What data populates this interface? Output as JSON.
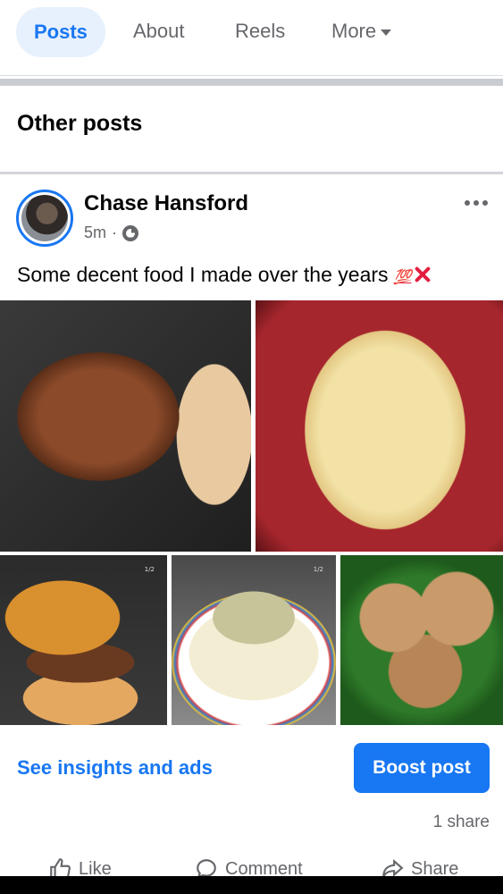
{
  "tabs": [
    {
      "label": "Posts",
      "active": true
    },
    {
      "label": "About"
    },
    {
      "label": "Reels"
    },
    {
      "label": "More"
    }
  ],
  "section": {
    "title": "Other posts"
  },
  "post": {
    "author": "Chase Hansford",
    "time": "5m",
    "separator": "·",
    "privacy_icon": "globe-icon",
    "caption": "Some decent food I made over the years",
    "caption_emoji_1": "💯",
    "caption_emoji_2": "💢",
    "photos": [
      {
        "subject": "burger patty and chicken on grill pan"
      },
      {
        "subject": "omelette in red pan"
      },
      {
        "subject": "burger in bun",
        "tag": "1/2"
      },
      {
        "subject": "penne pasta with chicken",
        "tag": "1/2"
      },
      {
        "subject": "meatballs with sauce on greens"
      }
    ]
  },
  "footer": {
    "insights_link": "See insights and ads",
    "boost_button": "Boost post",
    "share_count": "1 share"
  },
  "actions": {
    "like": "Like",
    "comment": "Comment",
    "share": "Share"
  },
  "colors": {
    "accent": "#1877f2",
    "secondary_text": "#65676b",
    "active_tab_bg": "#e7f0fd"
  }
}
